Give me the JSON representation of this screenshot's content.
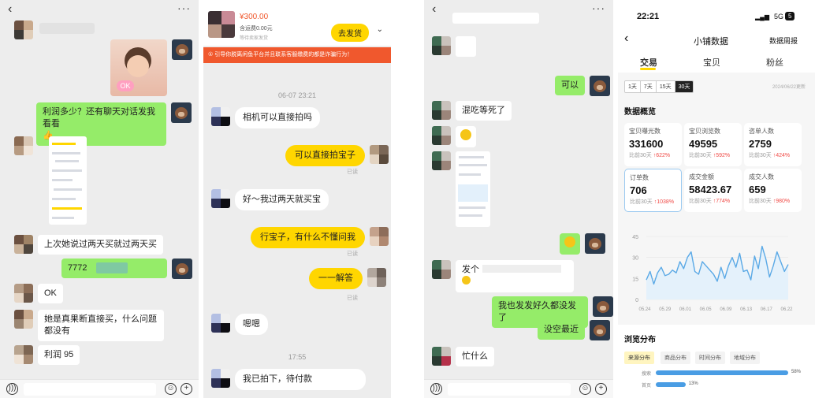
{
  "chat1": {
    "msgs": [
      "利润多少？还有聊天对话发我看看",
      "上次她说过两天买就过两天买",
      "7772",
      "OK",
      "她是真果断直接买，什么问题都没有",
      "利润 95"
    ],
    "sticker": "OK"
  },
  "chat2": {
    "order": {
      "price": "¥300.00",
      "shipping": "含运费0.00元",
      "status": "等待卖家发货",
      "ship_btn": "去发货"
    },
    "warning": "① 引导你脱离闲鱼平台并且联系客服缴费的都是诈骗行为！",
    "time1": "06-07 23:21",
    "time2": "17:55",
    "read": "已读",
    "msgs": [
      "相机可以直接拍吗",
      "可以直接拍宝子",
      "好～我过两天就买宝",
      "行宝子，有什么不懂问我",
      "一一解答",
      "嗯嗯",
      "我已拍下，待付款"
    ]
  },
  "chat3": {
    "msgs": [
      "可以",
      "混吃等死了",
      "发个",
      "我也发发好久都没发了",
      "没空最近",
      "忙什么"
    ]
  },
  "stats": {
    "status_time": "22:21",
    "signal": "5G",
    "battery": "5",
    "title": "小铺数据",
    "weekly": "数据周报",
    "tabs": [
      "交易",
      "宝贝",
      "粉丝"
    ],
    "ranges": [
      "1天",
      "7天",
      "15天",
      "30天"
    ],
    "updated": "2024/06/22更新",
    "overview": "数据概览",
    "cards": [
      {
        "label": "宝贝曝光数",
        "value": "331600",
        "cmp": "比前30天",
        "chg": "↑622%"
      },
      {
        "label": "宝贝浏览数",
        "value": "49595",
        "cmp": "比前30天",
        "chg": "↑592%"
      },
      {
        "label": "咨单人数",
        "value": "2759",
        "cmp": "比前30天",
        "chg": "↑424%"
      },
      {
        "label": "订单数",
        "value": "706",
        "cmp": "比前30天",
        "chg": "↑1038%"
      },
      {
        "label": "成交金额",
        "value": "58423.67",
        "cmp": "比前30天",
        "chg": "↑774%"
      },
      {
        "label": "成交人数",
        "value": "659",
        "cmp": "比前30天",
        "chg": "↑980%"
      }
    ],
    "browse": "浏览分布",
    "btabs": [
      "来源分布",
      "商品分布",
      "时间分布",
      "地域分布"
    ],
    "bars": [
      {
        "label": "搜索",
        "pct": "58%",
        "value": 58
      },
      {
        "label": "首页",
        "pct": "13%",
        "value": 13
      }
    ]
  },
  "chart_data": {
    "type": "line",
    "x": [
      "05.24",
      "05.29",
      "06.01",
      "06.05",
      "06.09",
      "06.13",
      "06.17",
      "06.22"
    ],
    "yticks": [
      "0",
      "15",
      "30",
      "45"
    ],
    "ylim": [
      0,
      45
    ],
    "series": [
      {
        "values": [
          14,
          20,
          11,
          19,
          23,
          17,
          18,
          21,
          19,
          27,
          22,
          30,
          34,
          20,
          18,
          27,
          24,
          21,
          18,
          13,
          23,
          15,
          24,
          30,
          23,
          33,
          20,
          21,
          14,
          31,
          22,
          38,
          29,
          16,
          24,
          34,
          27,
          20,
          25
        ]
      }
    ]
  },
  "colors": {
    "accent": "#ffd600",
    "wechat_green": "#95ec69",
    "line": "#5aa9e6",
    "bar": "#4a9de4",
    "up": "#f04a46",
    "warning": "#f0582d"
  }
}
